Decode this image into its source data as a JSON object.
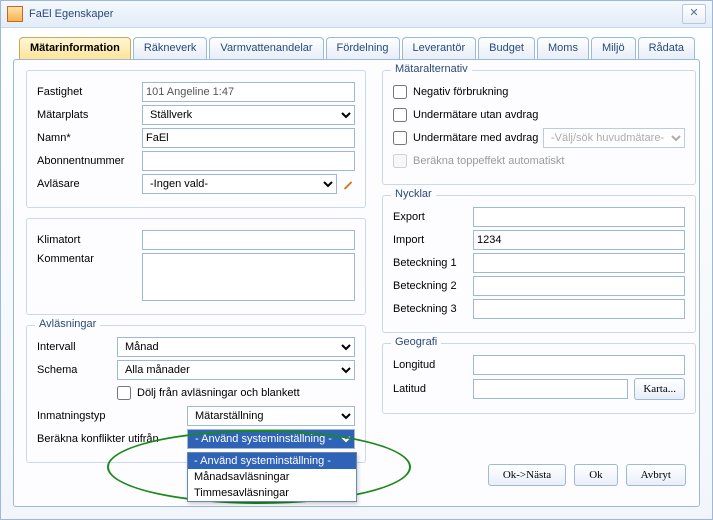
{
  "window": {
    "title": "FaEl Egenskaper"
  },
  "tabs": {
    "matarinformation": "Mätarinformation",
    "rakneverk": "Räkneverk",
    "varmvattenandelar": "Varmvattenandelar",
    "fordelning": "Fördelning",
    "leverantor": "Leverantör",
    "budget": "Budget",
    "moms": "Moms",
    "miljo": "Miljö",
    "radata": "Rådata"
  },
  "left_top": {
    "fastighet_label": "Fastighet",
    "fastighet_value": "101 Angeline 1:47",
    "matarplats_label": "Mätarplats",
    "matarplats_value": "Ställverk",
    "namn_label": "Namn*",
    "namn_value": "FaEl",
    "abonnentnummer_label": "Abonnentnummer",
    "abonnentnummer_value": "",
    "avlasare_label": "Avläsare",
    "avlasare_value": "-Ingen vald-"
  },
  "left_mid": {
    "klimatort_label": "Klimatort",
    "klimatort_value": "",
    "kommentar_label": "Kommentar",
    "kommentar_value": ""
  },
  "avlasningar": {
    "legend": "Avläsningar",
    "intervall_label": "Intervall",
    "intervall_value": "Månad",
    "schema_label": "Schema",
    "schema_value": "Alla månader",
    "hide_checkbox": "Dölj från avläsningar och blankett",
    "inmatningstyp_label": "Inmatningstyp",
    "inmatningstyp_value": "Mätarställning",
    "berakna_label": "Beräkna konflikter utifrån",
    "berakna_value": "- Använd systeminställning -",
    "dropdown_options": {
      "o1": "- Använd systeminställning -",
      "o2": "Månadsavläsningar",
      "o3": "Timmesavläsningar"
    }
  },
  "mataralternativ": {
    "legend": "Mätaralternativ",
    "negativ": "Negativ förbrukning",
    "under_utan": "Undermätare utan avdrag",
    "under_med": "Undermätare med avdrag",
    "huvud_placeholder": "-Välj/sök huvudmätare-",
    "berakna_topp": "Beräkna toppeffekt automatiskt"
  },
  "nycklar": {
    "legend": "Nycklar",
    "export_label": "Export",
    "export_value": "",
    "import_label": "Import",
    "import_value": "1234",
    "bet1_label": "Beteckning 1",
    "bet1_value": "",
    "bet2_label": "Beteckning 2",
    "bet2_value": "",
    "bet3_label": "Beteckning 3",
    "bet3_value": ""
  },
  "geografi": {
    "legend": "Geografi",
    "longitud_label": "Longitud",
    "longitud_value": "",
    "latitud_label": "Latitud",
    "latitud_value": "",
    "karta_btn": "Karta..."
  },
  "footer": {
    "ok_next": "Ok->Nästa",
    "ok": "Ok",
    "cancel": "Avbryt"
  }
}
